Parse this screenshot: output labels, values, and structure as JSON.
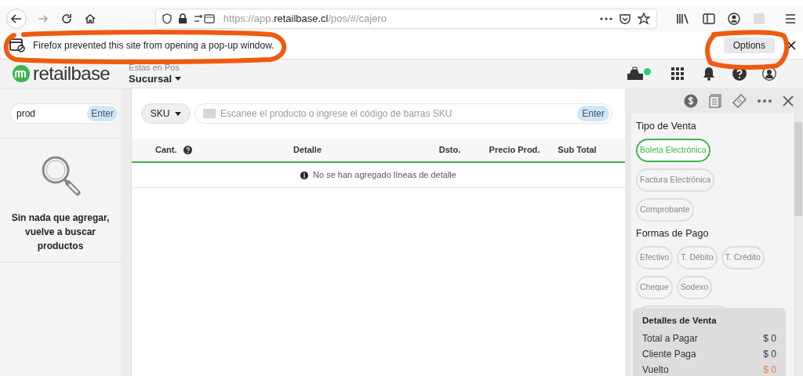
{
  "browser": {
    "url": {
      "start": "https://app.",
      "domain": "retailbase.cl",
      "path": "/pos/#/cajero"
    },
    "notification": {
      "text": "Firefox prevented this site from opening a pop-up window.",
      "button": "Options"
    }
  },
  "header": {
    "logo": "retailbase",
    "location_label": "Estas en Pos",
    "branch": "Sucursal",
    "online": true
  },
  "left_panel": {
    "search": {
      "value": "prod",
      "button": "Enter"
    },
    "empty_message": "Sin nada que agregar, vuelve a buscar productos"
  },
  "main": {
    "code_type": "SKU",
    "scan": {
      "placeholder": "Escanee el producto o ingrese el código de barras SKU",
      "button": "Enter"
    },
    "columns": [
      {
        "label": "Cant.",
        "help": true
      },
      {
        "label": "Detalle",
        "help": false
      },
      {
        "label": "Dsto.",
        "help": false
      },
      {
        "label": "Precio Prod.",
        "help": false
      },
      {
        "label": "Sub Total",
        "help": false
      }
    ],
    "empty_message": "No se han agregado líneas de detalle"
  },
  "right_panel": {
    "sections": [
      {
        "title": "Tipo de Venta",
        "options": [
          {
            "label": "Boleta Electrónica",
            "selected": true
          },
          {
            "label": "Factura Electrónica",
            "selected": false
          },
          {
            "label": "Comprobante",
            "selected": false
          }
        ]
      },
      {
        "title": "Formas de Pago",
        "options": [
          {
            "label": "Efectivo",
            "selected": false
          },
          {
            "label": "T. Débito",
            "selected": false
          },
          {
            "label": "T. Crédito",
            "selected": false
          },
          {
            "label": "Cheque",
            "selected": false
          },
          {
            "label": "Sodexo",
            "selected": false
          }
        ]
      }
    ],
    "details": {
      "title": "Detalles de Venta",
      "rows": [
        {
          "label": "Total a Pagar",
          "value": "$ 0",
          "color": "#333333"
        },
        {
          "label": "Cliente Paga",
          "value": "$ 0",
          "color": "#333333"
        },
        {
          "label": "Vuelto",
          "value": "$ 0",
          "color": "#f07c3a"
        }
      ]
    }
  }
}
